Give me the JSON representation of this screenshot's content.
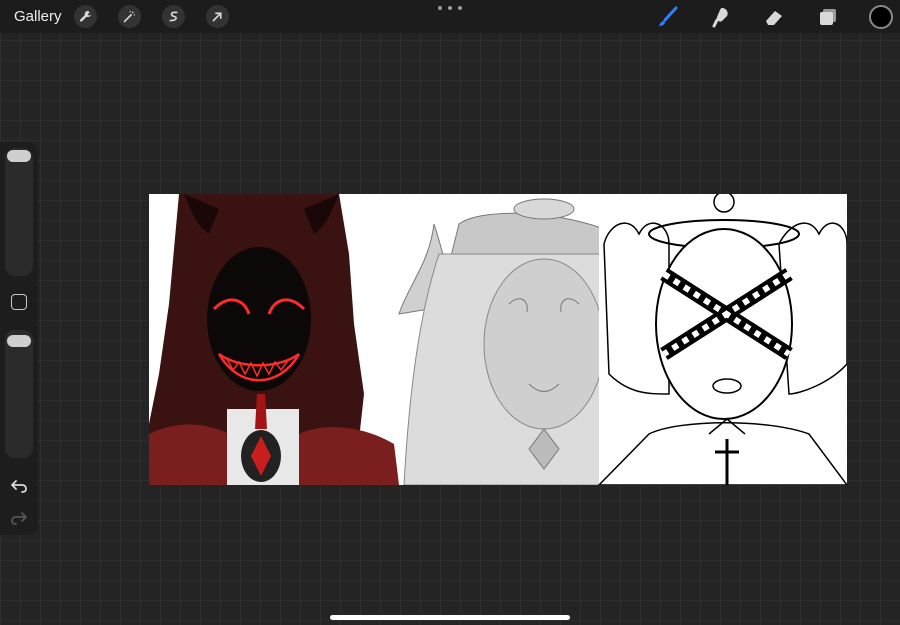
{
  "topbar": {
    "gallery_label": "Gallery",
    "left_tools": [
      "wrench-icon",
      "magic-wand-icon",
      "selection-icon",
      "transform-arrow-icon"
    ],
    "right_tools": [
      "brush-icon",
      "smudge-icon",
      "eraser-icon",
      "layers-icon"
    ],
    "active_tool": "brush-icon",
    "colors": {
      "accent": "#2f7fff",
      "current_color": "#000000"
    }
  },
  "sidebar": {
    "controls": [
      "brush-size-slider",
      "modify-button",
      "opacity-slider",
      "undo-icon",
      "redo-icon"
    ]
  },
  "canvas": {
    "description_colors": {
      "demon_hair": "#3a1010",
      "demon_glow": "#ff2020",
      "grey_figure": "#d4d4d4",
      "lineart": "#000000"
    }
  }
}
